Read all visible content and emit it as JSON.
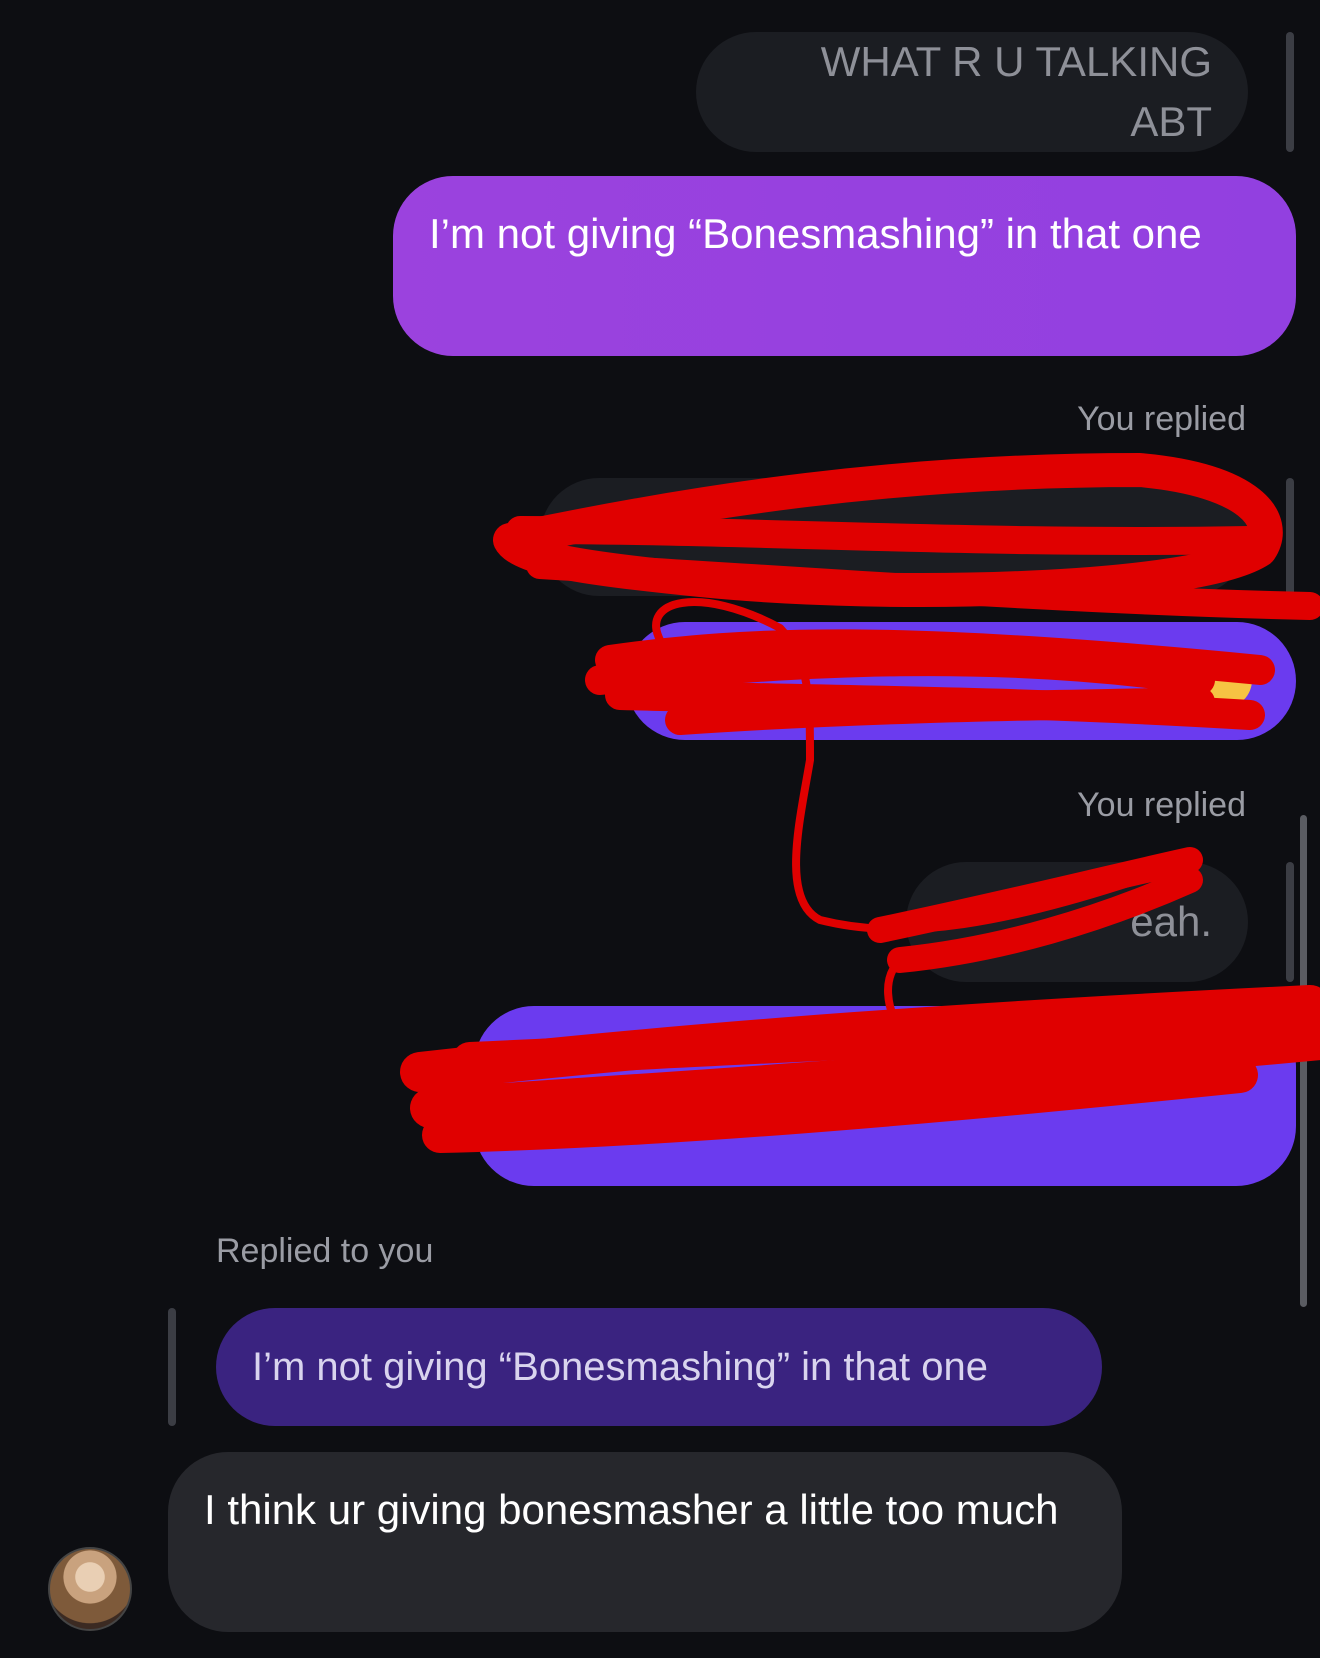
{
  "messages": {
    "m1_quoted": "WHAT R U TALKING ABT",
    "m1_sent": "I’m not giving “Bonesmashing” in that one",
    "m2_label": "You replied",
    "m3_label": "You replied",
    "m3_quoted_visible": "eah.",
    "m4_label": "Replied to you",
    "m4_quoted": "I’m not giving “Bonesmashing” in that one",
    "m4_received": "I think ur giving bonesmasher a little too much"
  },
  "colors": {
    "background": "#0d0e12",
    "sent_purple": "#9b42de",
    "sent_violet": "#6b3bef",
    "received_gray": "#26272c",
    "redaction_red": "#e00000"
  },
  "icons": [
    "avatar",
    "pensive-emoji"
  ]
}
